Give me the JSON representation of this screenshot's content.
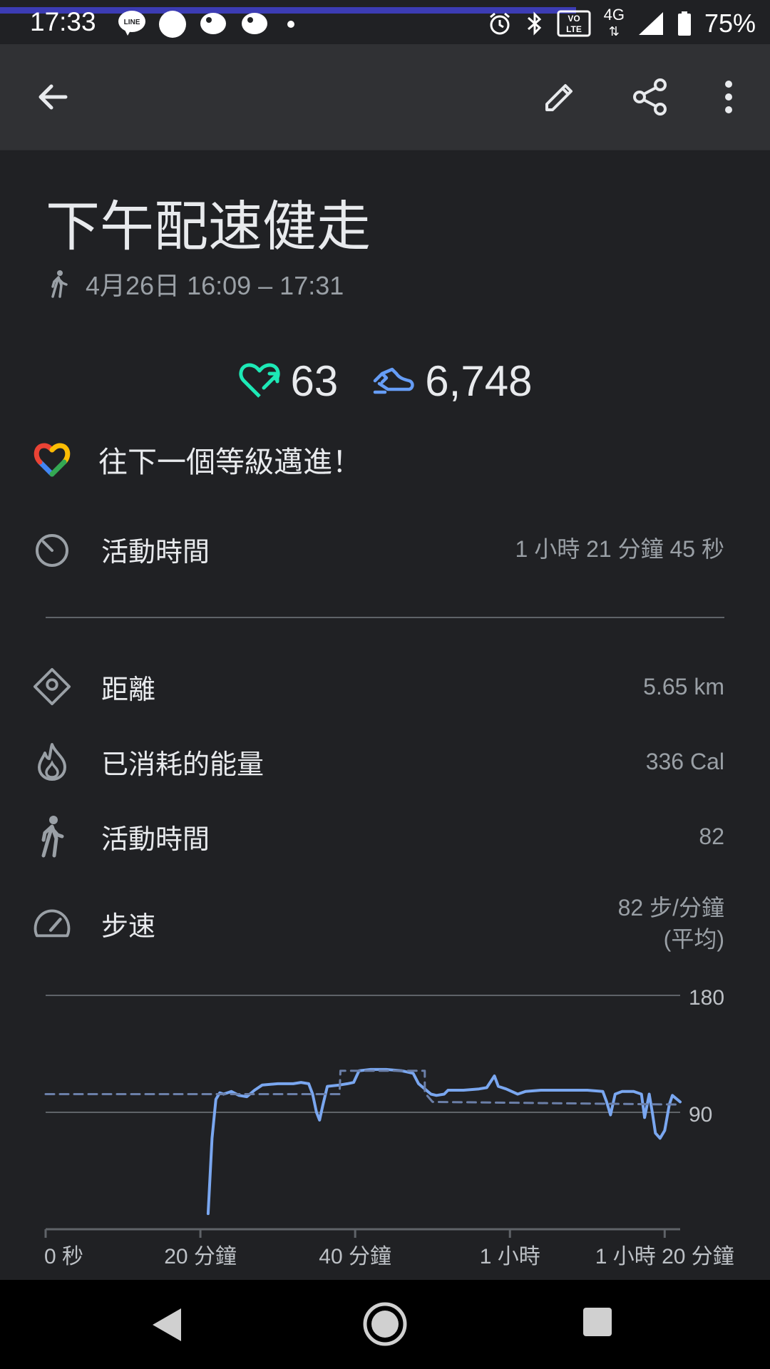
{
  "status_bar": {
    "time": "17:33",
    "battery": "75%",
    "network": "4G",
    "icons": [
      "line-icon",
      "circle-icon",
      "bird-icon",
      "bird-icon",
      "dot-icon",
      "alarm-icon",
      "bluetooth-icon",
      "volte-icon",
      "signal-icon",
      "battery-icon"
    ]
  },
  "app_bar": {
    "icons": [
      "back-arrow-icon",
      "edit-pencil-icon",
      "share-icon",
      "more-vert-icon"
    ]
  },
  "activity": {
    "title": "下午配速健走",
    "date_range": "4月26日 16:09 – 17:31",
    "heart_points": "63",
    "steps": "6,748",
    "goal_message": "往下一個等級邁進！"
  },
  "rows": [
    {
      "label": "活動時間",
      "value": "1 小時 21 分鐘 45 秒",
      "icon": "timer-icon"
    },
    {
      "label": "距離",
      "value": "5.65 km",
      "icon": "distance-icon"
    },
    {
      "label": "已消耗的能量",
      "value": "336 Cal",
      "icon": "fire-icon"
    },
    {
      "label": "活動時間",
      "value": "82",
      "icon": "walk-icon"
    },
    {
      "label": "步速",
      "value": "82 步/分鐘",
      "value2": "(平均)",
      "icon": "speedometer-icon"
    }
  ],
  "colors": {
    "background": "#202124",
    "appbar": "#303134",
    "heart": "#1de9b6",
    "steps": "#669df6",
    "line": "#7aa7f0",
    "dash": "#6b7fa8",
    "grid": "#5f6368"
  },
  "chart_data": {
    "type": "line",
    "xlabel": "",
    "ylabel": "",
    "ylim": [
      0,
      180
    ],
    "y_ticks": [
      "180",
      "90"
    ],
    "x_ticks": [
      "0 秒",
      "20 分鐘",
      "40 分鐘",
      "1 小時",
      "1 小時 20 分鐘"
    ],
    "x_tick_minutes": [
      0,
      20,
      40,
      60,
      80
    ],
    "xlim_minutes": [
      0,
      82
    ],
    "series": [
      {
        "values": [
          [
            21,
            12
          ],
          [
            21.5,
            70
          ],
          [
            22,
            100
          ],
          [
            22.5,
            105
          ],
          [
            23,
            104
          ],
          [
            24,
            106
          ],
          [
            25,
            103
          ],
          [
            26,
            102
          ],
          [
            27,
            107
          ],
          [
            28,
            111
          ],
          [
            30,
            112
          ],
          [
            32,
            112
          ],
          [
            33,
            113
          ],
          [
            34,
            112
          ],
          [
            34.5,
            104
          ],
          [
            35,
            90
          ],
          [
            35.4,
            84
          ],
          [
            35.8,
            95
          ],
          [
            36.4,
            110
          ],
          [
            38,
            111
          ],
          [
            39,
            112
          ],
          [
            39.8,
            113
          ],
          [
            40.5,
            122
          ],
          [
            42,
            123
          ],
          [
            44,
            123
          ],
          [
            46,
            122
          ],
          [
            47.5,
            120
          ],
          [
            48.2,
            112
          ],
          [
            49,
            108
          ],
          [
            49.8,
            104
          ],
          [
            50.5,
            103
          ],
          [
            51.5,
            104
          ],
          [
            52,
            107
          ],
          [
            54,
            107
          ],
          [
            56,
            108
          ],
          [
            57,
            109
          ],
          [
            58,
            118
          ],
          [
            58.5,
            110
          ],
          [
            59.5,
            108
          ],
          [
            61,
            104
          ],
          [
            62,
            106
          ],
          [
            64,
            107
          ],
          [
            67,
            107
          ],
          [
            70,
            107
          ],
          [
            72,
            106
          ],
          [
            72.5,
            98
          ],
          [
            73,
            88
          ],
          [
            73.6,
            104
          ],
          [
            74.5,
            106
          ],
          [
            76,
            106
          ],
          [
            77,
            104
          ],
          [
            77.4,
            86
          ],
          [
            78,
            104
          ],
          [
            78.4,
            90
          ],
          [
            78.8,
            74
          ],
          [
            79.4,
            70
          ],
          [
            80,
            76
          ],
          [
            80.6,
            96
          ],
          [
            81,
            103
          ],
          [
            82,
            98
          ]
        ]
      },
      {
        "dashed": true,
        "values": [
          [
            0,
            104
          ],
          [
            38,
            104
          ],
          [
            38,
            106
          ],
          [
            38.1,
            122
          ],
          [
            49,
            122
          ],
          [
            49,
            105
          ],
          [
            50,
            98
          ],
          [
            82,
            96
          ]
        ]
      }
    ]
  }
}
